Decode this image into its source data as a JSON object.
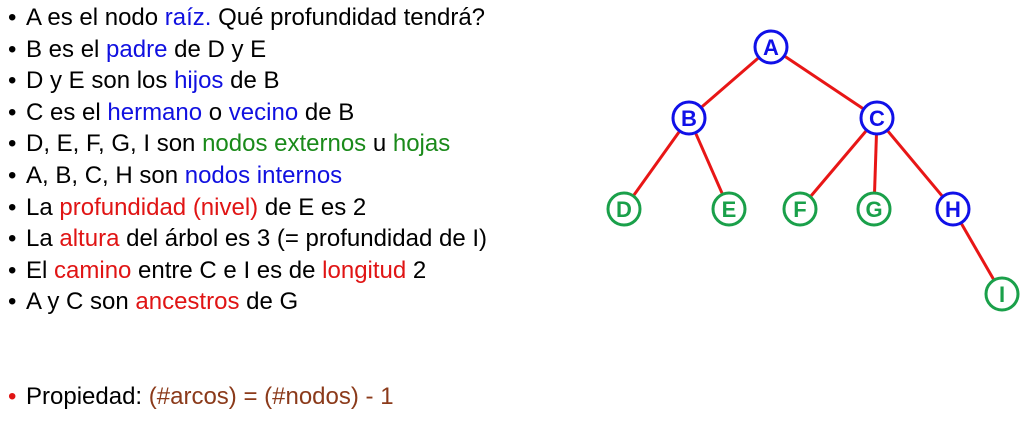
{
  "bullet_char": "•",
  "colors": {
    "default": "#000000",
    "blue": "#1010e0",
    "green": "#1a8a1a",
    "red": "#e01414",
    "brown": "#8b3a1a",
    "edge": "#e81616",
    "node_blue": "#1010e8",
    "node_green": "#1aa04a"
  },
  "bullets": [
    [
      {
        "t": "A es el nodo ",
        "c": "default"
      },
      {
        "t": "raíz.",
        "c": "blue"
      },
      {
        "t": " Qué profundidad tendrá?",
        "c": "default"
      }
    ],
    [
      {
        "t": "B es el ",
        "c": "default"
      },
      {
        "t": "padre",
        "c": "blue"
      },
      {
        "t": " de D y E",
        "c": "default"
      }
    ],
    [
      {
        "t": "D y E son los ",
        "c": "default"
      },
      {
        "t": "hijos",
        "c": "blue"
      },
      {
        "t": " de B",
        "c": "default"
      }
    ],
    [
      {
        "t": "C es el ",
        "c": "default"
      },
      {
        "t": "hermano",
        "c": "blue"
      },
      {
        "t": " o ",
        "c": "default"
      },
      {
        "t": "vecino",
        "c": "blue"
      },
      {
        "t": " de B",
        "c": "default"
      }
    ],
    [
      {
        "t": "D, E, F, G, I son ",
        "c": "default"
      },
      {
        "t": "nodos externos",
        "c": "green"
      },
      {
        "t": " u ",
        "c": "default"
      },
      {
        "t": "hojas",
        "c": "green"
      }
    ],
    [
      {
        "t": "A, B, C, H son ",
        "c": "default"
      },
      {
        "t": "nodos internos",
        "c": "blue"
      }
    ],
    [
      {
        "t": "La ",
        "c": "default"
      },
      {
        "t": "profundidad (nivel)",
        "c": "red"
      },
      {
        "t": " de E es 2",
        "c": "default"
      }
    ],
    [
      {
        "t": "La ",
        "c": "default"
      },
      {
        "t": "altura",
        "c": "red"
      },
      {
        "t": " del árbol es 3 (= profundidad de I)",
        "c": "default"
      }
    ],
    [
      {
        "t": "El ",
        "c": "default"
      },
      {
        "t": "camino",
        "c": "red"
      },
      {
        "t": " entre C e I es de ",
        "c": "default"
      },
      {
        "t": "longitud",
        "c": "red"
      },
      {
        "t": " 2",
        "c": "default"
      }
    ],
    [
      {
        "t": "A y C son ",
        "c": "default"
      },
      {
        "t": "ancestros",
        "c": "red"
      },
      {
        "t": " de G",
        "c": "default"
      }
    ]
  ],
  "property": {
    "bullet": "•",
    "label": "Propiedad: ",
    "formula": "(#arcos) = (#nodos) - 1"
  },
  "tree": {
    "nodes": [
      {
        "id": "A",
        "label": "A",
        "kind": "internal"
      },
      {
        "id": "B",
        "label": "B",
        "kind": "internal"
      },
      {
        "id": "C",
        "label": "C",
        "kind": "internal"
      },
      {
        "id": "D",
        "label": "D",
        "kind": "leaf"
      },
      {
        "id": "E",
        "label": "E",
        "kind": "leaf"
      },
      {
        "id": "F",
        "label": "F",
        "kind": "leaf"
      },
      {
        "id": "G",
        "label": "G",
        "kind": "leaf"
      },
      {
        "id": "H",
        "label": "H",
        "kind": "internal"
      },
      {
        "id": "I",
        "label": "I",
        "kind": "leaf"
      }
    ],
    "edges": [
      [
        "A",
        "B"
      ],
      [
        "A",
        "C"
      ],
      [
        "B",
        "D"
      ],
      [
        "B",
        "E"
      ],
      [
        "C",
        "F"
      ],
      [
        "C",
        "G"
      ],
      [
        "C",
        "H"
      ],
      [
        "H",
        "I"
      ]
    ]
  }
}
